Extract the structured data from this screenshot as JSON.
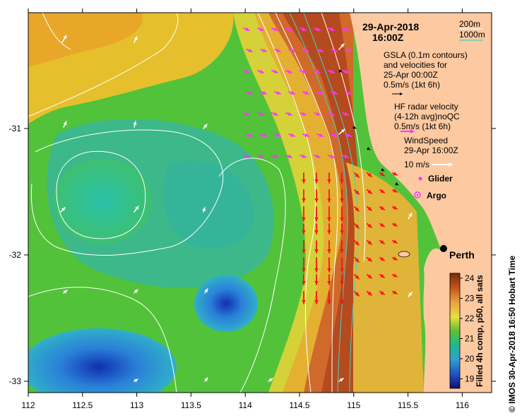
{
  "map": {
    "date": "29-Apr-2018",
    "time": "16:00Z",
    "place_label": "Perth",
    "depth_contours": {
      "shallow": "200m",
      "deep": "1000m",
      "shallow_color": "#ffffff",
      "deep_color": "#3fd4c4"
    },
    "legend": {
      "gsla_lines": [
        "GSLA (0.1m contours)",
        "and velocities for",
        "25-Apr 00:00Z",
        "0.5m/s (1kt 6h)"
      ],
      "hf_lines": [
        "HF radar velocity",
        "(4-12h avg)noQC",
        "0.5m/s (1kt 6h)"
      ],
      "wind_lines": [
        "WindSpeed",
        "29-Apr 16:00Z",
        "10 m/s"
      ],
      "glider": "Glider",
      "argo": "Argo",
      "glider_color": "#ff33ff",
      "argo_color": "#ff33ff"
    },
    "colorbar": {
      "ticks": [
        "24",
        "23",
        "22",
        "21",
        "20",
        "19"
      ],
      "label": "Filled 4h comp, p50, all sats"
    },
    "credit": "© IMOS 30-Apr-2018 16:50 Hobart Time",
    "axes": {
      "x_ticks": [
        "112",
        "112.5",
        "113",
        "113.5",
        "114",
        "114.5",
        "115",
        "115.5",
        "116"
      ],
      "y_ticks": [
        "-31",
        "-32",
        "-33"
      ]
    },
    "colors": {
      "land": "#fcc9a1",
      "vector_gsla": "#000000",
      "vector_hf_north": "#ff33ff",
      "vector_hf_south": "#ff1111",
      "vector_wind": "#ffffff"
    }
  }
}
